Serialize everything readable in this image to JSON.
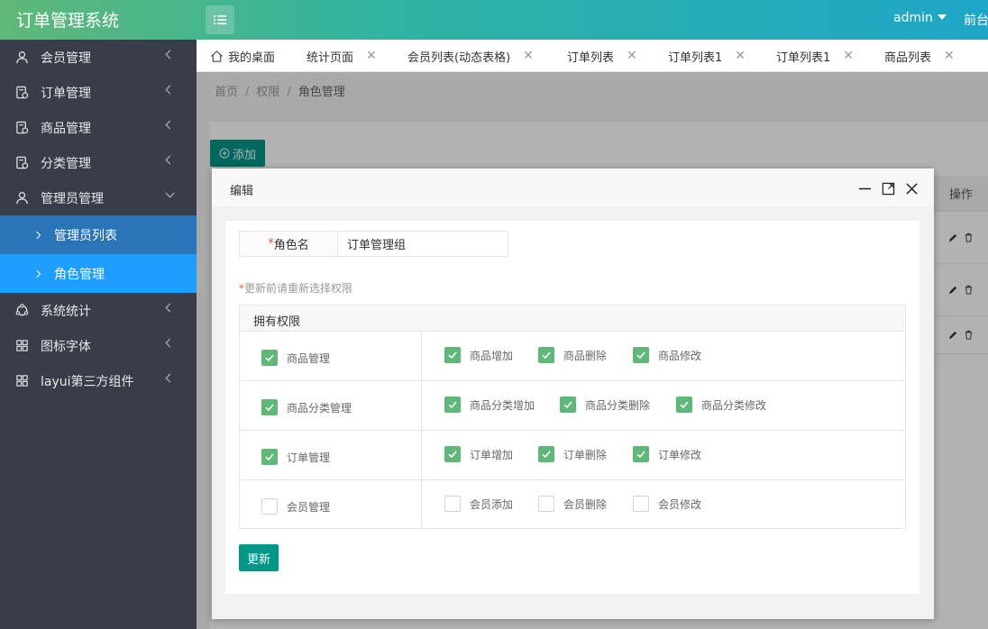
{
  "app": {
    "title": "订单管理系统",
    "user": "admin",
    "front": "前台"
  },
  "sidebar": {
    "items": [
      {
        "label": "会员管理"
      },
      {
        "label": "订单管理"
      },
      {
        "label": "商品管理"
      },
      {
        "label": "分类管理"
      },
      {
        "label": "管理员管理"
      },
      {
        "label": "系统统计"
      },
      {
        "label": "图标字体"
      },
      {
        "label": "layui第三方组件"
      }
    ],
    "sub_items": [
      {
        "label": "管理员列表"
      },
      {
        "label": "角色管理"
      }
    ]
  },
  "tabs": [
    {
      "label": "我的桌面"
    },
    {
      "label": "统计页面"
    },
    {
      "label": "会员列表(动态表格)"
    },
    {
      "label": "订单列表"
    },
    {
      "label": "订单列表1"
    },
    {
      "label": "订单列表1"
    },
    {
      "label": "商品列表"
    }
  ],
  "breadcrumb": {
    "items": [
      "首页",
      "权限",
      "角色管理"
    ]
  },
  "toolbar": {
    "add_label": "添加",
    "op_header": "操作"
  },
  "dialog": {
    "title": "编辑",
    "role_label": "角色名",
    "required_mark": "*",
    "role_value": "订单管理组",
    "note": "更新前请重新选择权限",
    "table_header": "拥有权限",
    "groups": [
      {
        "label": "商品管理",
        "checked": true,
        "perms": [
          {
            "label": "商品增加",
            "checked": true
          },
          {
            "label": "商品删除",
            "checked": true
          },
          {
            "label": "商品修改",
            "checked": true
          }
        ]
      },
      {
        "label": "商品分类管理",
        "checked": true,
        "perms": [
          {
            "label": "商品分类增加",
            "checked": true
          },
          {
            "label": "商品分类删除",
            "checked": true
          },
          {
            "label": "商品分类修改",
            "checked": true
          }
        ]
      },
      {
        "label": "订单管理",
        "checked": true,
        "perms": [
          {
            "label": "订单增加",
            "checked": true
          },
          {
            "label": "订单删除",
            "checked": true
          },
          {
            "label": "订单修改",
            "checked": true
          }
        ]
      },
      {
        "label": "会员管理",
        "checked": false,
        "perms": [
          {
            "label": "会员添加",
            "checked": false
          },
          {
            "label": "会员删除",
            "checked": false
          },
          {
            "label": "会员修改",
            "checked": false
          }
        ]
      }
    ],
    "update_label": "更新"
  },
  "colors": {
    "header_start": "#5fb878",
    "header_end": "#1ea6c8",
    "sidebar": "#393d49",
    "active": "#1e9fff",
    "primary_button": "#009688",
    "checkbox": "#5fb878"
  }
}
